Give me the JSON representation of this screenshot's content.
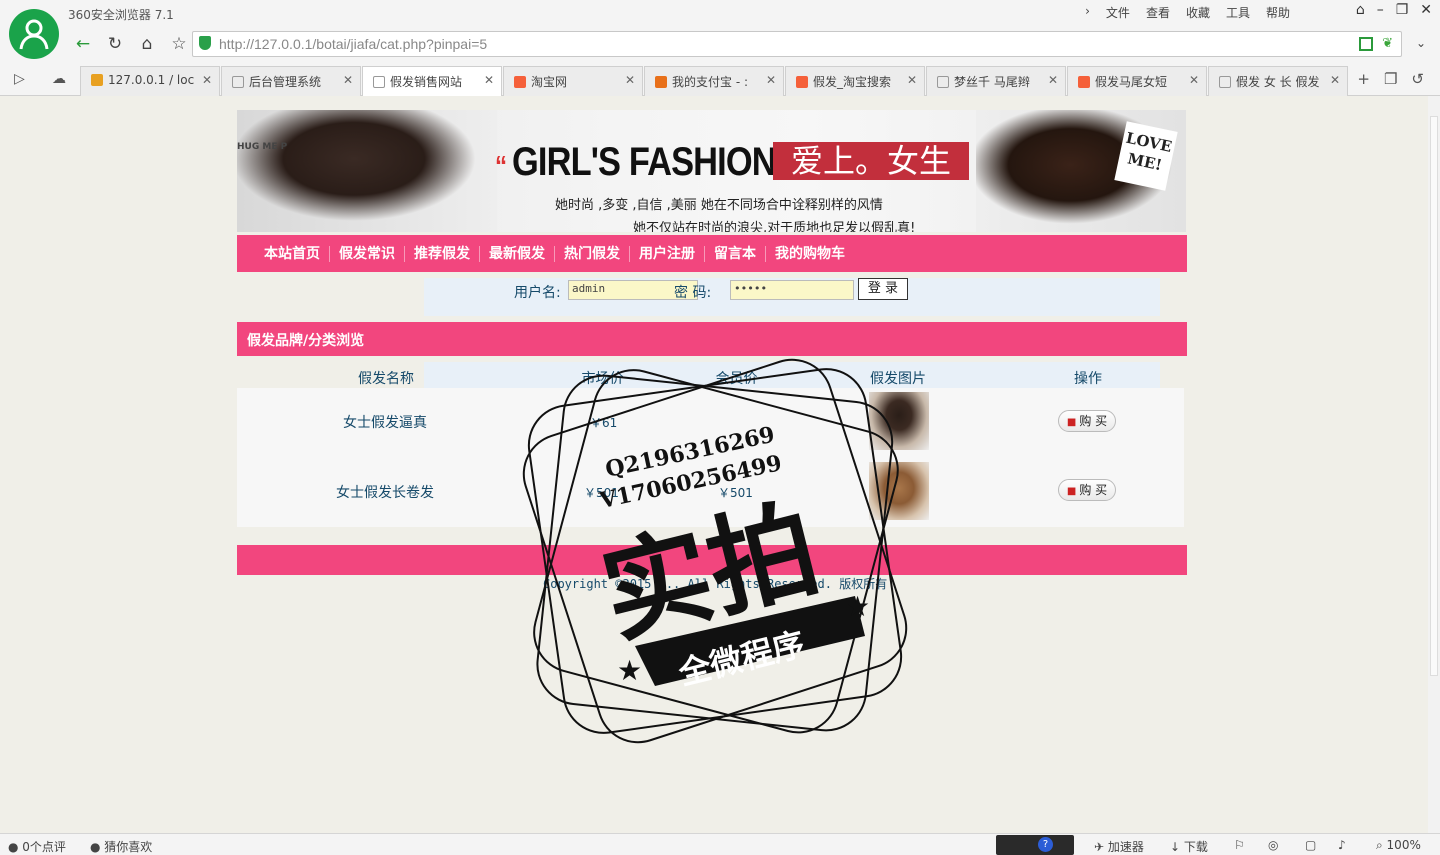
{
  "browser": {
    "app_title": "360安全浏览器 7.1",
    "menu": [
      "文件",
      "查看",
      "收藏",
      "工具",
      "帮助"
    ],
    "url": "http://127.0.0.1/botai/jiafa/cat.php?pinpai=5",
    "tabs": [
      {
        "label": "127.0.0.1 / loc",
        "icon": "pma-icon",
        "active": false
      },
      {
        "label": "后台管理系统",
        "icon": "page-icon",
        "active": false
      },
      {
        "label": "假发销售网站",
        "icon": "page-icon",
        "active": true
      },
      {
        "label": "淘宝网",
        "icon": "taobao-icon",
        "active": false
      },
      {
        "label": "我的支付宝 - :",
        "icon": "alipay-icon",
        "active": false
      },
      {
        "label": "假发_淘宝搜索",
        "icon": "taobao-icon",
        "active": false
      },
      {
        "label": "梦丝千 马尾辫",
        "icon": "page-icon",
        "active": false
      },
      {
        "label": "假发马尾女短",
        "icon": "taobao-icon",
        "active": false
      },
      {
        "label": "假发 女 长 假发",
        "icon": "page-icon",
        "active": false
      }
    ]
  },
  "site": {
    "banner": {
      "headline": "GIRL'S FASHION",
      "headline_cn": "爱上。女生",
      "slogan1": "她时尚 ,多变 ,自信 ,美丽 她在不同场合中诠释别样的风情",
      "slogan2": "她不仅站在时尚的浪尖,对于质地也足发以假乱真!",
      "badge": "LOVE ME!",
      "hug": "HUG ME P"
    },
    "nav": [
      "本站首页",
      "假发常识",
      "推荐假发",
      "最新假发",
      "热门假发",
      "用户注册",
      "留言本",
      "我的购物车"
    ],
    "login": {
      "user_label": "用户名:",
      "user_value": "admin",
      "pass_label": "密 码:",
      "pass_value": "•••••",
      "submit": "登 录"
    },
    "section_title": "假发品牌/分类浏览",
    "table": {
      "headers": [
        "假发名称",
        "市场价",
        "会员价",
        "假发图片",
        "操作"
      ],
      "rows": [
        {
          "name": "女士假发逼真",
          "market": "￥61",
          "member": "",
          "action": "购 买"
        },
        {
          "name": "女士假发长卷发",
          "market": "￥501",
          "member": "￥501",
          "action": "购 买"
        }
      ]
    },
    "copyright": "Copyright ©2015 ... All Rights Reserved. 版权所有"
  },
  "watermark": {
    "line1": "Q2196316269",
    "line2": "V17060256499",
    "big": "实拍",
    "ribbon": "全微程序"
  },
  "status": {
    "comments": "0个点评",
    "guess": "猜你喜欢",
    "accelerator": "加速器",
    "download": "下载",
    "zoom": "100%"
  },
  "colors": {
    "pink": "#f2467e",
    "text_blue": "#164a6a",
    "green": "#1aa34a"
  }
}
